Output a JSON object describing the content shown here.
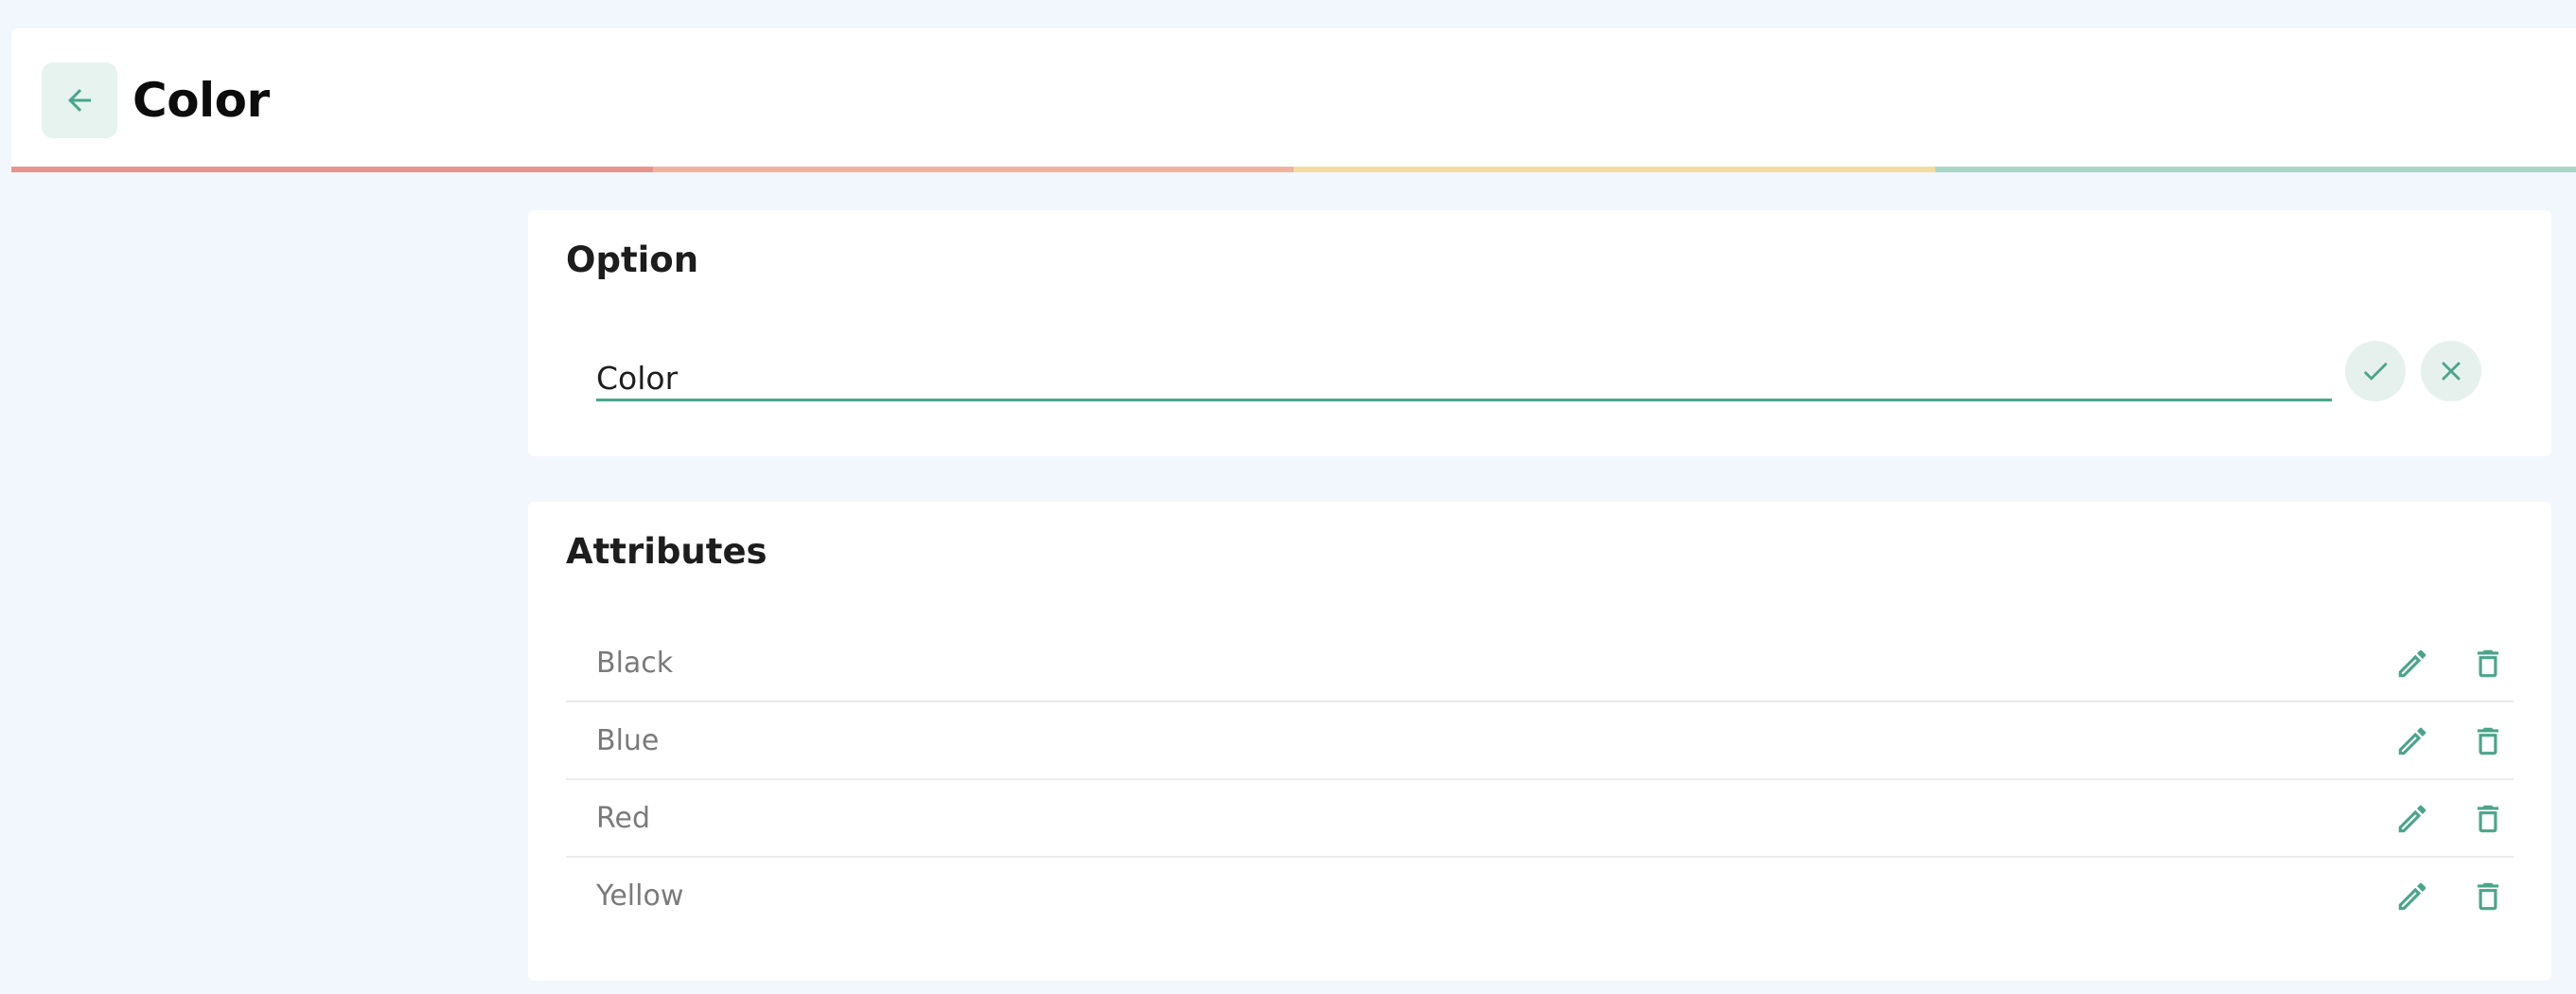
{
  "header": {
    "title": "Color",
    "back_icon": "arrow-left-icon",
    "stripe_colors": [
      "#e8948c",
      "#f1b29e",
      "#f4dc9e",
      "#a8d6c6"
    ]
  },
  "option_card": {
    "heading": "Option",
    "input_value": "Color",
    "confirm_icon": "check-icon",
    "cancel_icon": "close-icon"
  },
  "attributes_card": {
    "heading": "Attributes",
    "items": [
      {
        "label": "Black"
      },
      {
        "label": "Blue"
      },
      {
        "label": "Red"
      },
      {
        "label": "Yellow"
      }
    ],
    "edit_icon": "pencil-icon",
    "delete_icon": "trash-icon"
  },
  "colors": {
    "accent": "#4aa58a",
    "page_background": "#f2f6fd",
    "icon_button_background": "#e6f1ee"
  }
}
